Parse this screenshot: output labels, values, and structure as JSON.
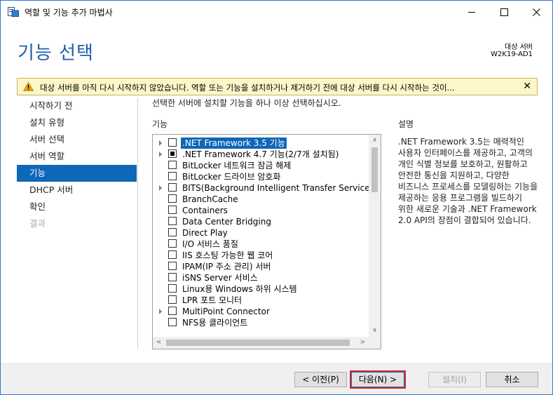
{
  "window": {
    "title": "역할 및 기능 추가 마법사"
  },
  "header": {
    "page_title": "기능 선택",
    "destination_label": "대상 서버",
    "destination_server": "W2K19-AD1"
  },
  "warning": {
    "text": "대상 서버를 아직 다시 시작하지 않았습니다. 역할 또는 기능을 설치하거나 제거하기 전에 대상 서버를 다시 시작하는 것이...",
    "close": "✕"
  },
  "nav": {
    "items": [
      {
        "label": "시작하기 전",
        "state": "normal"
      },
      {
        "label": "설치 유형",
        "state": "normal"
      },
      {
        "label": "서버 선택",
        "state": "normal"
      },
      {
        "label": "서버 역할",
        "state": "normal"
      },
      {
        "label": "기능",
        "state": "active"
      },
      {
        "label": "DHCP 서버",
        "state": "normal"
      },
      {
        "label": "확인",
        "state": "normal"
      },
      {
        "label": "결과",
        "state": "disabled"
      }
    ]
  },
  "main": {
    "instruction": "선택한 서버에 설치할 기능을 하나 이상 선택하십시오.",
    "features_heading": "기능",
    "description_heading": "설명",
    "description_text": ".NET Framework 3.5는 매력적인 사용자 인터페이스를 제공하고, 고객의 개인 식별 정보를 보호하고, 원활하고 안전한 통신을 지원하고, 다양한 비즈니스 프로세스를 모델링하는 기능을 제공하는 응용 프로그램을 빌드하기 위한 새로운 기술과 .NET Framework 2.0 API의 장점이 결합되어 있습니다.",
    "features": [
      {
        "label": ".NET Framework 3.5 기능",
        "expandable": true,
        "state": "unchecked",
        "selected": true
      },
      {
        "label": ".NET Framework 4.7 기능(2/7개 설치됨)",
        "expandable": true,
        "state": "partial",
        "selected": false
      },
      {
        "label": "BitLocker 네트워크 잠금 해제",
        "expandable": false,
        "state": "unchecked",
        "selected": false
      },
      {
        "label": "BitLocker 드라이브 암호화",
        "expandable": false,
        "state": "unchecked",
        "selected": false
      },
      {
        "label": "BITS(Background Intelligent Transfer Service)",
        "expandable": true,
        "state": "unchecked",
        "selected": false
      },
      {
        "label": "BranchCache",
        "expandable": false,
        "state": "unchecked",
        "selected": false
      },
      {
        "label": "Containers",
        "expandable": false,
        "state": "unchecked",
        "selected": false
      },
      {
        "label": "Data Center Bridging",
        "expandable": false,
        "state": "unchecked",
        "selected": false
      },
      {
        "label": "Direct Play",
        "expandable": false,
        "state": "unchecked",
        "selected": false
      },
      {
        "label": "I/O 서비스 품질",
        "expandable": false,
        "state": "unchecked",
        "selected": false
      },
      {
        "label": "IIS 호스팅 가능한 웹 코어",
        "expandable": false,
        "state": "unchecked",
        "selected": false
      },
      {
        "label": "IPAM(IP 주소 관리) 서버",
        "expandable": false,
        "state": "unchecked",
        "selected": false
      },
      {
        "label": "iSNS Server 서비스",
        "expandable": false,
        "state": "unchecked",
        "selected": false
      },
      {
        "label": "Linux용 Windows 하위 시스템",
        "expandable": false,
        "state": "unchecked",
        "selected": false
      },
      {
        "label": "LPR 포트 모니터",
        "expandable": false,
        "state": "unchecked",
        "selected": false
      },
      {
        "label": "MultiPoint Connector",
        "expandable": true,
        "state": "unchecked",
        "selected": false
      },
      {
        "label": "NFS용 클라이언트",
        "expandable": false,
        "state": "unchecked",
        "selected": false
      }
    ]
  },
  "footer": {
    "prev": "< 이전(P)",
    "next": "다음(N) >",
    "install": "설치(I)",
    "cancel": "취소"
  },
  "colors": {
    "accent": "#0e67b7",
    "title_blue": "#1e5ea8",
    "warning_bg": "#fcf6c8",
    "highlight_border": "#e02020"
  }
}
